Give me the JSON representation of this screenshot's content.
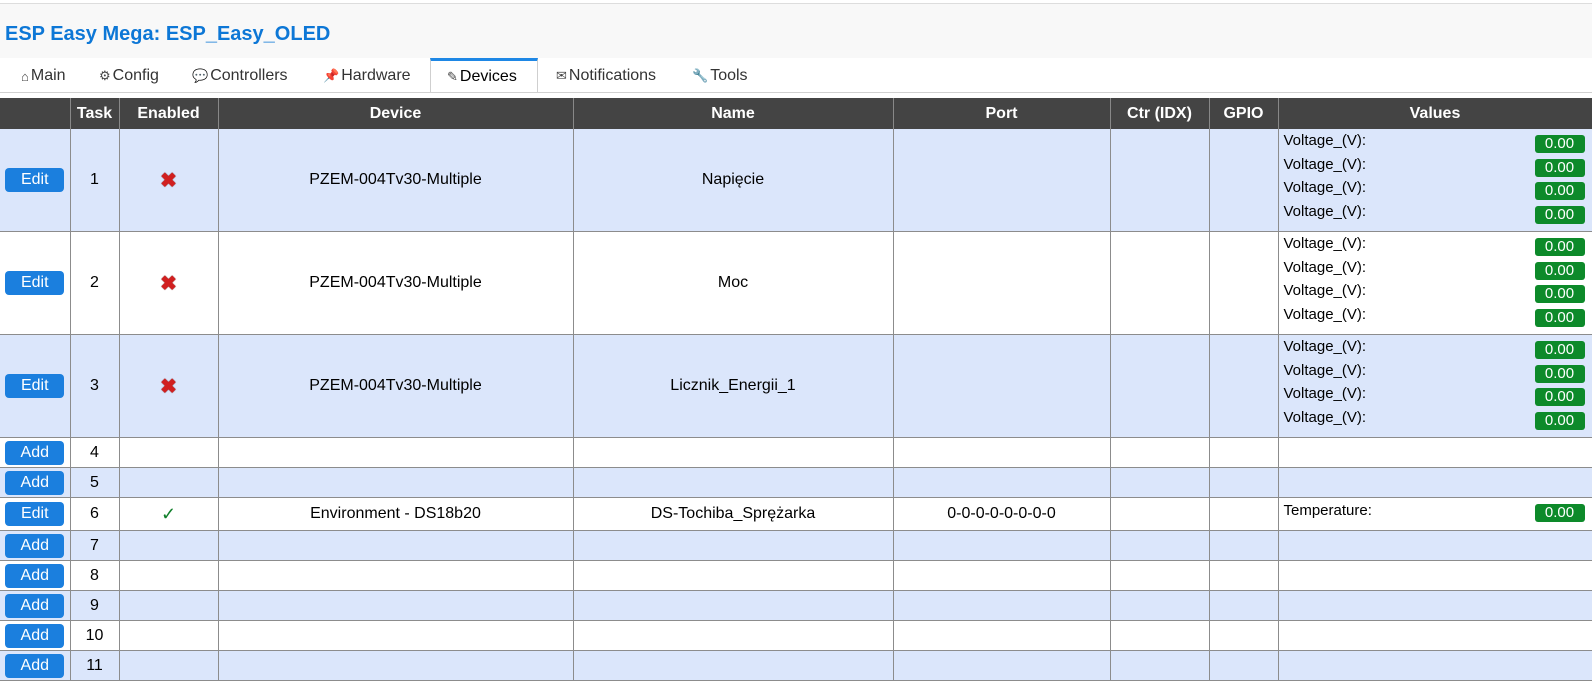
{
  "app": {
    "title": "ESP Easy Mega: ESP_Easy_OLED"
  },
  "tabs": [
    {
      "label": "Main",
      "icon": "home-icon",
      "glyph": "⌂"
    },
    {
      "label": "Config",
      "icon": "gear-icon",
      "glyph": "⚙"
    },
    {
      "label": "Controllers",
      "icon": "chat-icon",
      "glyph": "💬"
    },
    {
      "label": "Hardware",
      "icon": "pin-icon",
      "glyph": "📌"
    },
    {
      "label": "Devices",
      "icon": "plug-icon",
      "glyph": "✎"
    },
    {
      "label": "Notifications",
      "icon": "envelope-icon",
      "glyph": "✉"
    },
    {
      "label": "Tools",
      "icon": "wrench-icon",
      "glyph": "🔧"
    }
  ],
  "active_tab": "Devices",
  "table": {
    "columns": [
      "",
      "Task",
      "Enabled",
      "Device",
      "Name",
      "Port",
      "Ctr (IDX)",
      "GPIO",
      "Values"
    ],
    "rows": [
      {
        "button": "Edit",
        "task": "1",
        "enabled": "✖",
        "device": "PZEM-004Tv30-Multiple",
        "name": "Napięcie",
        "port": "",
        "ctr": "",
        "gpio": "",
        "values": [
          {
            "label": "Voltage_(V):",
            "value": "0.00"
          },
          {
            "label": "Voltage_(V):",
            "value": "0.00"
          },
          {
            "label": "Voltage_(V):",
            "value": "0.00"
          },
          {
            "label": "Voltage_(V):",
            "value": "0.00"
          }
        ]
      },
      {
        "button": "Edit",
        "task": "2",
        "enabled": "✖",
        "device": "PZEM-004Tv30-Multiple",
        "name": "Moc",
        "port": "",
        "ctr": "",
        "gpio": "",
        "values": [
          {
            "label": "Voltage_(V):",
            "value": "0.00"
          },
          {
            "label": "Voltage_(V):",
            "value": "0.00"
          },
          {
            "label": "Voltage_(V):",
            "value": "0.00"
          },
          {
            "label": "Voltage_(V):",
            "value": "0.00"
          }
        ]
      },
      {
        "button": "Edit",
        "task": "3",
        "enabled": "✖",
        "device": "PZEM-004Tv30-Multiple",
        "name": "Licznik_Energii_1",
        "port": "",
        "ctr": "",
        "gpio": "",
        "values": [
          {
            "label": "Voltage_(V):",
            "value": "0.00"
          },
          {
            "label": "Voltage_(V):",
            "value": "0.00"
          },
          {
            "label": "Voltage_(V):",
            "value": "0.00"
          },
          {
            "label": "Voltage_(V):",
            "value": "0.00"
          }
        ]
      },
      {
        "button": "Add",
        "task": "4",
        "enabled": "",
        "device": "",
        "name": "",
        "port": "",
        "ctr": "",
        "gpio": "",
        "values": []
      },
      {
        "button": "Add",
        "task": "5",
        "enabled": "",
        "device": "",
        "name": "",
        "port": "",
        "ctr": "",
        "gpio": "",
        "values": []
      },
      {
        "button": "Edit",
        "task": "6",
        "enabled": "✓",
        "device": "Environment - DS18b20",
        "name": "DS-Tochiba_Sprężarka",
        "port": "0-0-0-0-0-0-0-0",
        "ctr": "",
        "gpio": "",
        "values": [
          {
            "label": "Temperature:",
            "value": "0.00"
          }
        ]
      },
      {
        "button": "Add",
        "task": "7",
        "enabled": "",
        "device": "",
        "name": "",
        "port": "",
        "ctr": "",
        "gpio": "",
        "values": []
      },
      {
        "button": "Add",
        "task": "8",
        "enabled": "",
        "device": "",
        "name": "",
        "port": "",
        "ctr": "",
        "gpio": "",
        "values": []
      },
      {
        "button": "Add",
        "task": "9",
        "enabled": "",
        "device": "",
        "name": "",
        "port": "",
        "ctr": "",
        "gpio": "",
        "values": []
      },
      {
        "button": "Add",
        "task": "10",
        "enabled": "",
        "device": "",
        "name": "",
        "port": "",
        "ctr": "",
        "gpio": "",
        "values": []
      },
      {
        "button": "Add",
        "task": "11",
        "enabled": "",
        "device": "",
        "name": "",
        "port": "",
        "ctr": "",
        "gpio": "",
        "values": []
      }
    ]
  },
  "colors": {
    "title": "#0d77d6",
    "header_bg": "#444444",
    "row_alt": "#dbe6fb",
    "button": "#1b7fde",
    "value_badge": "#0d8a2a",
    "disabled_cross": "#d11f1f",
    "enabled_check": "#12802c"
  }
}
